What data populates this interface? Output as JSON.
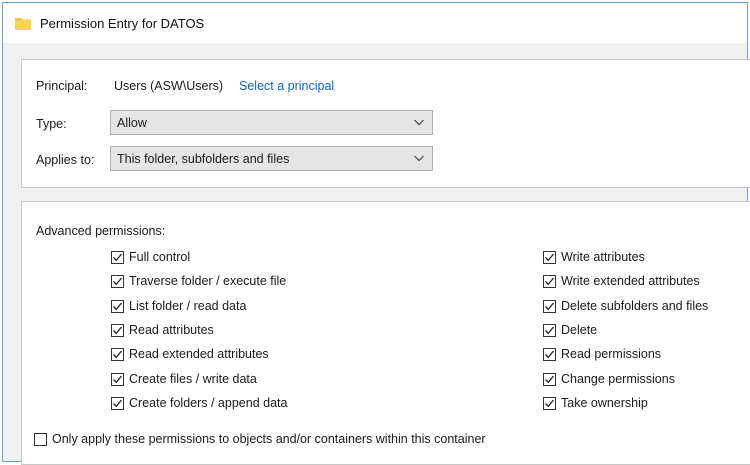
{
  "window": {
    "title": "Permission Entry for DATOS"
  },
  "principal": {
    "label": "Principal:",
    "value": "Users (ASW\\Users)",
    "link": "Select a principal"
  },
  "type": {
    "label": "Type:",
    "selected": "Allow"
  },
  "applies_to": {
    "label": "Applies to:",
    "selected": "This folder, subfolders and files"
  },
  "advanced": {
    "heading": "Advanced permissions:",
    "left": [
      {
        "label": "Full control",
        "checked": true
      },
      {
        "label": "Traverse folder / execute file",
        "checked": true
      },
      {
        "label": "List folder / read data",
        "checked": true
      },
      {
        "label": "Read attributes",
        "checked": true
      },
      {
        "label": "Read extended attributes",
        "checked": true
      },
      {
        "label": "Create files / write data",
        "checked": true
      },
      {
        "label": "Create folders / append data",
        "checked": true
      }
    ],
    "right": [
      {
        "label": "Write attributes",
        "checked": true
      },
      {
        "label": "Write extended attributes",
        "checked": true
      },
      {
        "label": "Delete subfolders and files",
        "checked": true
      },
      {
        "label": "Delete",
        "checked": true
      },
      {
        "label": "Read permissions",
        "checked": true
      },
      {
        "label": "Change permissions",
        "checked": true
      },
      {
        "label": "Take ownership",
        "checked": true
      }
    ]
  },
  "only_apply": {
    "label": "Only apply these permissions to objects and/or containers within this container",
    "checked": false
  },
  "colors": {
    "accent": "#0a63c9",
    "folder": "#f5c542",
    "window_border": "#6e9fd6"
  },
  "icons": {
    "window": "folder-icon",
    "dropdown": "chevron-down-icon",
    "check": "checkmark-icon"
  }
}
